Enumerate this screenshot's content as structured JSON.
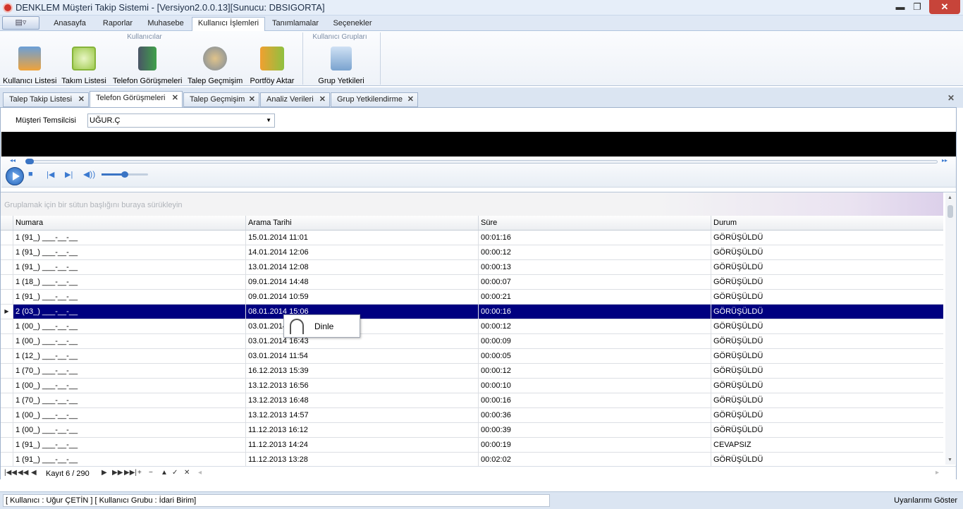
{
  "window": {
    "title": "DENKLEM Müşteri Takip Sistemi - [Versiyon2.0.0.13][Sunucu: DBSIGORTA]",
    "minimize": "▬",
    "restore": "❐",
    "close": "✕"
  },
  "ribbon_tabs": [
    "Anasayfa",
    "Raporlar",
    "Muhasebe",
    "Kullanıcı İşlemleri",
    "Tanımlamalar",
    "Seçenekler"
  ],
  "ribbon_groups": {
    "users": {
      "title": "Kullanıcılar",
      "buttons": [
        "Kullanıcı Listesi",
        "Takım Listesi",
        "Telefon Görüşmeleri",
        "Talep Geçmişim",
        "Portföy Aktar"
      ]
    },
    "user_groups": {
      "title": "Kullanıcı Grupları",
      "buttons": [
        "Grup Yetkileri"
      ]
    }
  },
  "doc_tabs": [
    "Talep Takip Listesi",
    "Telefon Görüşmeleri",
    "Talep Geçmişim",
    "Analiz Verileri",
    "Grup Yetkilendirme"
  ],
  "filter": {
    "label": "Müşteri Temsilcisi",
    "value": "UĞUR.Ç"
  },
  "grid": {
    "group_hint": "Gruplamak için bir sütun başlığını buraya sürükleyin",
    "columns": [
      "Numara",
      "Arama Tarihi",
      "Süre",
      "Durum"
    ],
    "rows": [
      [
        "1 (91_) ___-__-__",
        "15.01.2014 11:01",
        "00:01:16",
        "GÖRÜŞÜLDÜ"
      ],
      [
        "1 (91_) ___-__-__",
        "14.01.2014 12:06",
        "00:00:12",
        "GÖRÜŞÜLDÜ"
      ],
      [
        "1 (91_) ___-__-__",
        "13.01.2014 12:08",
        "00:00:13",
        "GÖRÜŞÜLDÜ"
      ],
      [
        "1 (18_) ___-__-__",
        "09.01.2014 14:48",
        "00:00:07",
        "GÖRÜŞÜLDÜ"
      ],
      [
        "1 (91_) ___-__-__",
        "09.01.2014 10:59",
        "00:00:21",
        "GÖRÜŞÜLDÜ"
      ],
      [
        "2 (03_) ___-__-__",
        "08.01.2014 15:06",
        "00:00:16",
        "GÖRÜŞÜLDÜ"
      ],
      [
        "1 (00_) ___-__-__",
        "03.01.2014",
        "00:00:12",
        "GÖRÜŞÜLDÜ"
      ],
      [
        "1 (00_) ___-__-__",
        "03.01.2014 16:43",
        "00:00:09",
        "GÖRÜŞÜLDÜ"
      ],
      [
        "1 (12_) ___-__-__",
        "03.01.2014 11:54",
        "00:00:05",
        "GÖRÜŞÜLDÜ"
      ],
      [
        "1 (70_) ___-__-__",
        "16.12.2013 15:39",
        "00:00:12",
        "GÖRÜŞÜLDÜ"
      ],
      [
        "1 (00_) ___-__-__",
        "13.12.2013 16:56",
        "00:00:10",
        "GÖRÜŞÜLDÜ"
      ],
      [
        "1 (70_) ___-__-__",
        "13.12.2013 16:48",
        "00:00:16",
        "GÖRÜŞÜLDÜ"
      ],
      [
        "1 (00_) ___-__-__",
        "13.12.2013 14:57",
        "00:00:36",
        "GÖRÜŞÜLDÜ"
      ],
      [
        "1 (00_) ___-__-__",
        "11.12.2013 16:12",
        "00:00:39",
        "GÖRÜŞÜLDÜ"
      ],
      [
        "1 (91_) ___-__-__",
        "11.12.2013 14:24",
        "00:00:19",
        "CEVAPSIZ"
      ],
      [
        "1 (91_) ___-__-__",
        "11.12.2013 13:28",
        "00:02:02",
        "GÖRÜŞÜLDÜ"
      ]
    ],
    "record_info": "Kayıt 6 / 290"
  },
  "context_menu": {
    "item": "Dinle"
  },
  "status": {
    "user_info": "[ Kullanıcı : Uğur ÇETİN ] [ Kullanıcı Grubu : İdari Birim]",
    "alerts": "Uyarılarımı Göster"
  }
}
